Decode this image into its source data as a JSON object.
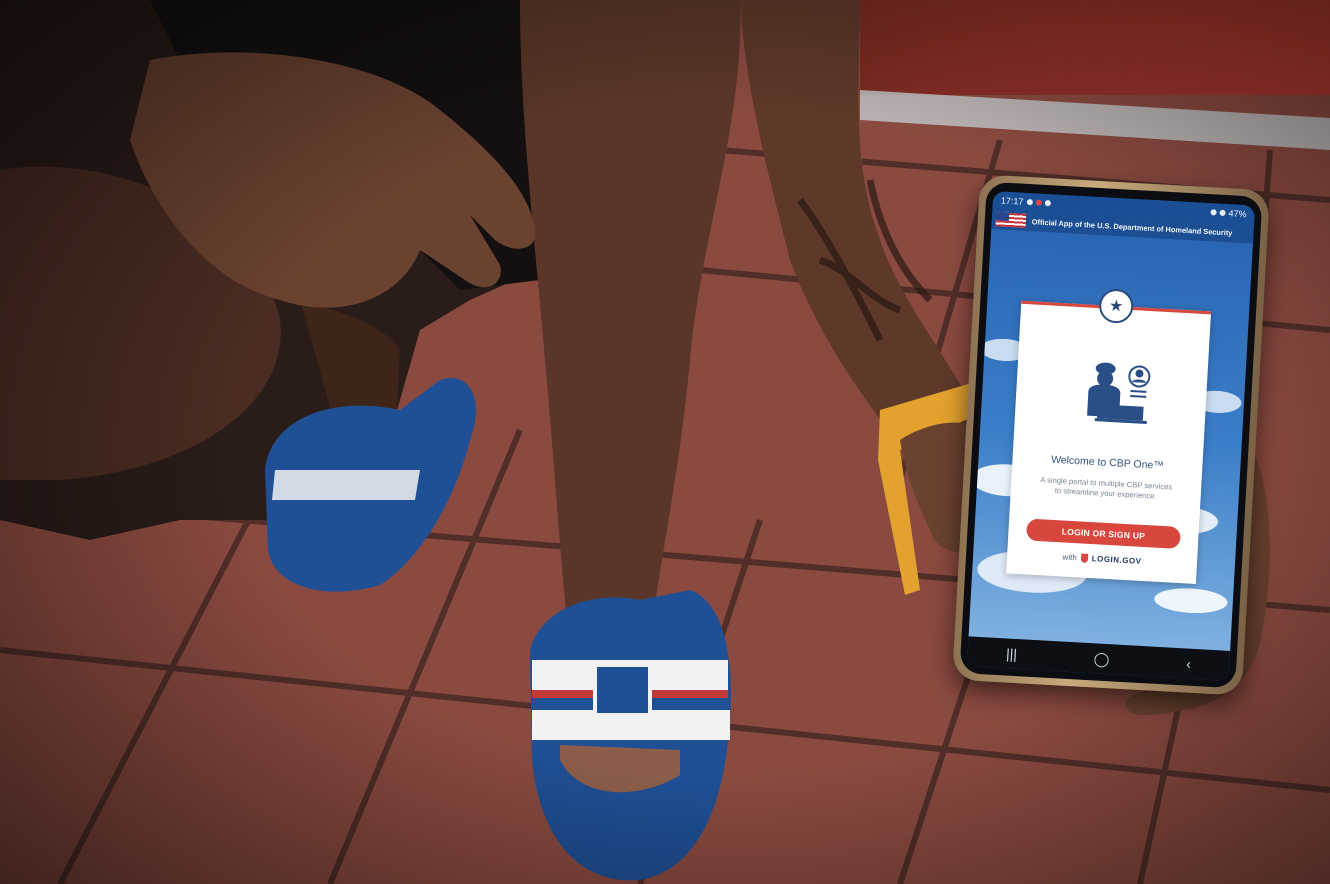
{
  "image": {
    "description_colors": {
      "tile": "#8a4a40",
      "grout": "#3e2520",
      "skin": "#5a3628",
      "sandal_blue": "#1f4f95",
      "watchband": "#e3a12e"
    }
  },
  "phone": {
    "status": {
      "time": "17:17",
      "battery": "47%"
    },
    "gov_banner": "Official App of the U.S. Department of Homeland Security",
    "card": {
      "title": "Welcome to CBP One™",
      "subtitle": "A single portal to multiple CBP services to streamline your experience.",
      "login_button": "LOGIN OR SIGN UP",
      "with_label": "with",
      "provider": "LOGIN.GOV"
    },
    "nav": {
      "recent": "|||",
      "home": "◯",
      "back": "‹"
    },
    "colors": {
      "accent_red": "#d8473d",
      "navy": "#1b4e92",
      "sky_blue": "#3b7fc8"
    }
  }
}
